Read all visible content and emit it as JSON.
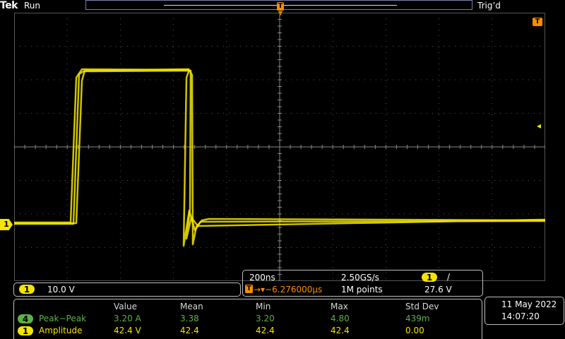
{
  "header": {
    "brand": "Tek",
    "run_state": "Run",
    "trigger_state": "Trig’d"
  },
  "markers": {
    "trigger_position": "T",
    "trigger_level_right": "T",
    "trigger_level_arrow": "◂"
  },
  "channel1": {
    "marker_label": "1",
    "badge": "1",
    "scale": "10.0 V",
    "color": "#f5e400"
  },
  "timebase": {
    "horizontal_scale": "200ns",
    "sample_rate": "2.50GS/s",
    "trigger_source_badge": "1",
    "trigger_slope": "/",
    "trigger_badge": "T",
    "trigger_delay": "→▾−6.276000μs",
    "record_length": "1M points",
    "trigger_level": "27.6 V"
  },
  "measurements": {
    "headers": [
      "Value",
      "Mean",
      "Min",
      "Max",
      "Std Dev"
    ],
    "rows": [
      {
        "badge": "4",
        "name": "Peak−Peak",
        "value": "3.20 A",
        "mean": "3.38",
        "min": "3.20",
        "max": "4.80",
        "std": "439m",
        "color": "#5ab248"
      },
      {
        "badge": "1",
        "name": "Amplitude",
        "value": "42.4 V",
        "mean": "42.4",
        "min": "42.4",
        "max": "42.4",
        "std": "0.00",
        "color": "#f5e400"
      }
    ]
  },
  "datetime": {
    "date": "11 May 2022",
    "time": "14:07:20"
  },
  "colors": {
    "trace": "#f5e400",
    "trigger": "#ff8c00",
    "channel4": "#5ab248",
    "graticule": "#555555"
  }
}
